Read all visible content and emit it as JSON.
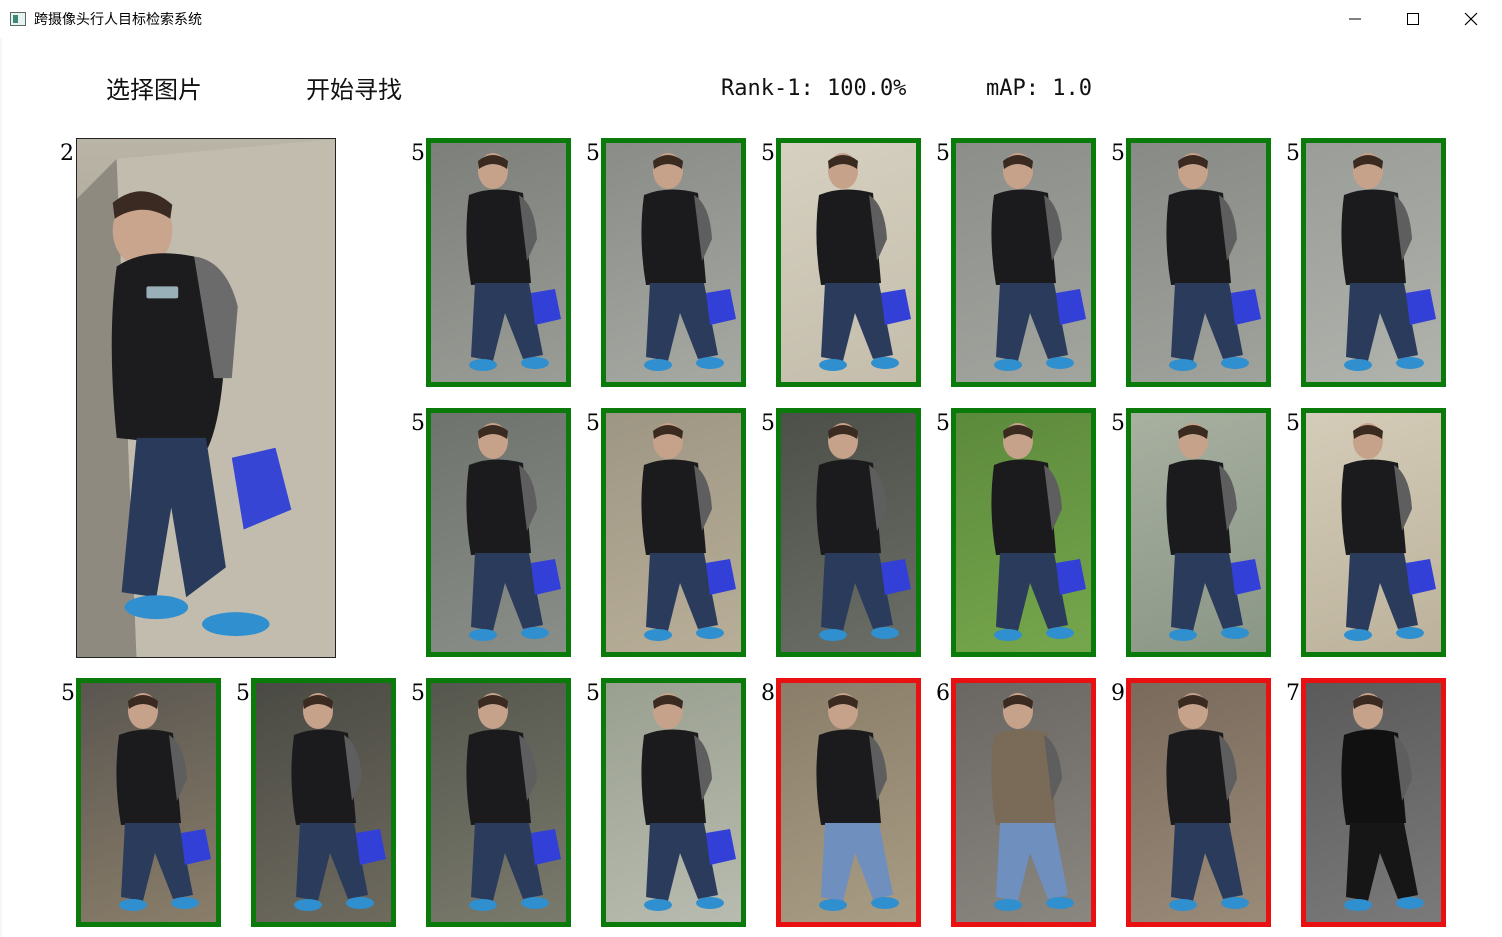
{
  "window": {
    "title": "跨摄像头行人目标检索系统",
    "controls": [
      "minimize-icon",
      "maximize-icon",
      "close-icon"
    ]
  },
  "toolbar": {
    "select_image_label": "选择图片",
    "start_search_label": "开始寻找"
  },
  "metrics": {
    "rank1_text": "Rank-1: 100.0%",
    "map_text": "mAP: 1.0"
  },
  "query": {
    "id_label": "2"
  },
  "colors": {
    "match_border": "#0a7a0a",
    "mismatch_border": "#e81010"
  },
  "results": [
    {
      "id_label": "5",
      "match": true
    },
    {
      "id_label": "5",
      "match": true
    },
    {
      "id_label": "5",
      "match": true
    },
    {
      "id_label": "5",
      "match": true
    },
    {
      "id_label": "5",
      "match": true
    },
    {
      "id_label": "5",
      "match": true
    },
    {
      "id_label": "5",
      "match": true
    },
    {
      "id_label": "5",
      "match": true
    },
    {
      "id_label": "5",
      "match": true
    },
    {
      "id_label": "5",
      "match": true
    },
    {
      "id_label": "5",
      "match": true
    },
    {
      "id_label": "5",
      "match": true
    },
    {
      "id_label": "5",
      "match": true
    },
    {
      "id_label": "5",
      "match": true
    },
    {
      "id_label": "5",
      "match": true
    },
    {
      "id_label": "5",
      "match": true
    },
    {
      "id_label": "8",
      "match": false
    },
    {
      "id_label": "6",
      "match": false
    },
    {
      "id_label": "9",
      "match": false
    },
    {
      "id_label": "7",
      "match": false
    }
  ]
}
